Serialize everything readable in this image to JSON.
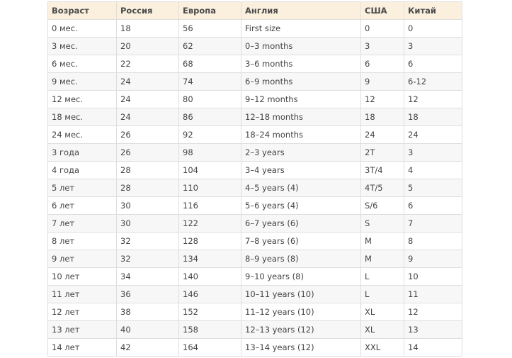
{
  "table": {
    "headers": [
      "Возраст",
      "Россия",
      "Европа",
      "Англия",
      "США",
      "Китай"
    ],
    "rows": [
      [
        "0 мес.",
        "18",
        "56",
        "First size",
        "0",
        "0"
      ],
      [
        "3 мес.",
        "20",
        "62",
        "0–3 months",
        "3",
        "3"
      ],
      [
        "6 мес.",
        "22",
        "68",
        "3–6 months",
        "6",
        "6"
      ],
      [
        "9 мес.",
        "24",
        "74",
        "6–9 months",
        "9",
        "6-12"
      ],
      [
        "12 мес.",
        "24",
        "80",
        "9–12 months",
        "12",
        "12"
      ],
      [
        "18 мес.",
        "24",
        "86",
        "12–18 months",
        "18",
        "18"
      ],
      [
        "24 мес.",
        "26",
        "92",
        "18–24 months",
        "24",
        "24"
      ],
      [
        "3 года",
        "26",
        "98",
        "2–3 years",
        "2T",
        "3"
      ],
      [
        "4 года",
        "28",
        "104",
        "3–4 years",
        "3T/4",
        "4"
      ],
      [
        "5 лет",
        "28",
        "110",
        "4–5 years (4)",
        "4T/5",
        "5"
      ],
      [
        "6 лет",
        "30",
        "116",
        "5–6 years (4)",
        "S/6",
        "6"
      ],
      [
        "7 лет",
        "30",
        "122",
        "6–7 years (6)",
        "S",
        "7"
      ],
      [
        "8 лет",
        "32",
        "128",
        "7–8 years (6)",
        "M",
        "8"
      ],
      [
        "9 лет",
        "32",
        "134",
        "8–9 years (8)",
        "M",
        "9"
      ],
      [
        "10 лет",
        "34",
        "140",
        "9–10 years (8)",
        "L",
        "10"
      ],
      [
        "11 лет",
        "36",
        "146",
        "10–11 years (10)",
        "L",
        "11"
      ],
      [
        "12 лет",
        "38",
        "152",
        "11–12 years (10)",
        "XL",
        "12"
      ],
      [
        "13 лет",
        "40",
        "158",
        "12–13 years (12)",
        "XL",
        "13"
      ],
      [
        "14 лет",
        "42",
        "164",
        "13–14 years (12)",
        "XXL",
        "14"
      ]
    ]
  },
  "colors": {
    "header_background": "#fbf0de",
    "border": "#dedede",
    "stripe": "#f7f7f7",
    "text": "#444444"
  }
}
